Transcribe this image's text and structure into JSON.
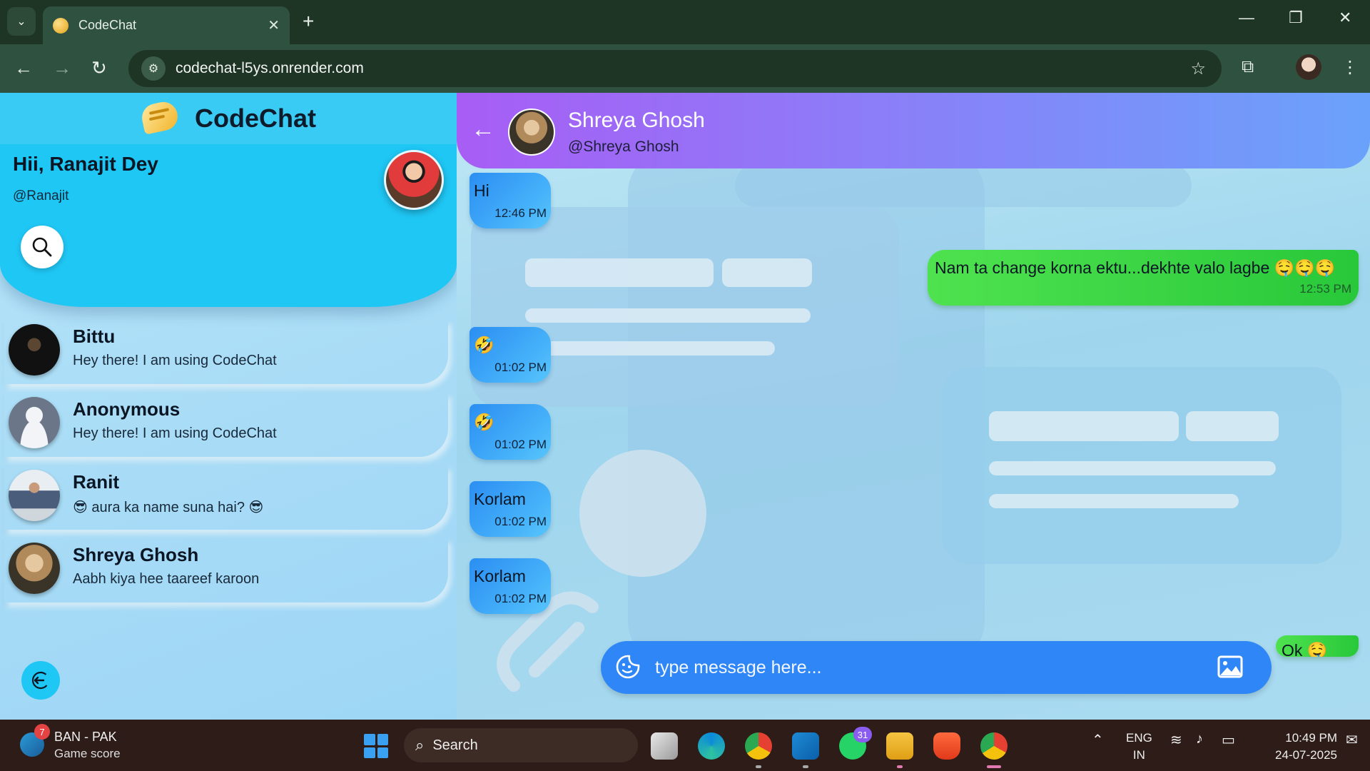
{
  "browser": {
    "tab_title": "CodeChat",
    "tab_close": "✕",
    "new_tab": "+",
    "url": "codechat-l5ys.onrender.com",
    "icons": [
      "chevron-down-icon",
      "back-icon",
      "forward-icon",
      "reload-icon",
      "site-info-icon",
      "star-icon",
      "extensions-icon",
      "menu-icon",
      "minimize-icon",
      "restore-icon",
      "close-icon"
    ]
  },
  "sidebar": {
    "app_name": "CodeChat",
    "greeting": "Hii, Ranajit Dey",
    "handle": "@Ranajit",
    "contacts": [
      {
        "name": "Bittu",
        "message": "Hey there! I am using CodeChat"
      },
      {
        "name": "Anonymous",
        "message": "Hey there! I am using CodeChat"
      },
      {
        "name": "Ranit",
        "message": "😎 aura ka name suna hai? 😎"
      },
      {
        "name": "Shreya Ghosh",
        "message": "Aabh kiya hee taareef karoon"
      }
    ]
  },
  "chat": {
    "peer_name": "Shreya Ghosh",
    "peer_handle": "@Shreya Ghosh",
    "messages": [
      {
        "direction": "in",
        "text": "Hi",
        "time": "12:46 PM"
      },
      {
        "direction": "out",
        "text": "Nam ta change korna ektu...dekhte valo lagbe 🤤🤤🤤",
        "time": "12:53 PM"
      },
      {
        "direction": "in",
        "text": "🤣",
        "time": "01:02 PM"
      },
      {
        "direction": "in",
        "text": "🤣",
        "time": "01:02 PM"
      },
      {
        "direction": "in",
        "text": "Korlam",
        "time": "01:02 PM"
      },
      {
        "direction": "in",
        "text": "Korlam",
        "time": "01:02 PM"
      },
      {
        "direction": "out",
        "text": "Ok 🤤",
        "time": ""
      }
    ],
    "composer_placeholder": "type message here...",
    "colors": {
      "incoming": "#2b8ef2",
      "outgoing": "#28c83a",
      "header_start": "#a85df5",
      "header_end": "#6aa2fb"
    }
  },
  "taskbar": {
    "widget_title": "BAN - PAK",
    "widget_subtitle": "Game score",
    "widget_badge": "7",
    "search_label": "Search",
    "whatsapp_badge": "31",
    "lang_line1": "ENG",
    "lang_line2": "IN",
    "time": "10:49 PM",
    "date": "24-07-2025"
  }
}
